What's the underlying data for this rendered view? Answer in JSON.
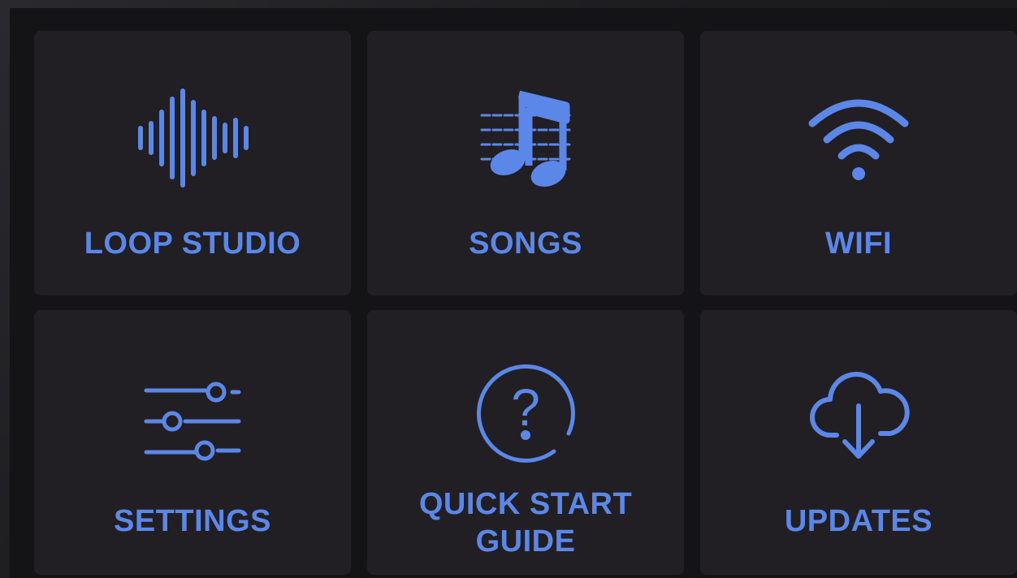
{
  "accent_color": "#5b88e8",
  "tiles": [
    {
      "label": "LOOP STUDIO",
      "icon": "waveform-icon"
    },
    {
      "label": "SONGS",
      "icon": "music-notes-icon"
    },
    {
      "label": "WIFI",
      "icon": "wifi-icon"
    },
    {
      "label": "SETTINGS",
      "icon": "sliders-icon"
    },
    {
      "label": "QUICK START GUIDE",
      "icon": "help-circle-icon"
    },
    {
      "label": "UPDATES",
      "icon": "cloud-download-icon"
    }
  ]
}
